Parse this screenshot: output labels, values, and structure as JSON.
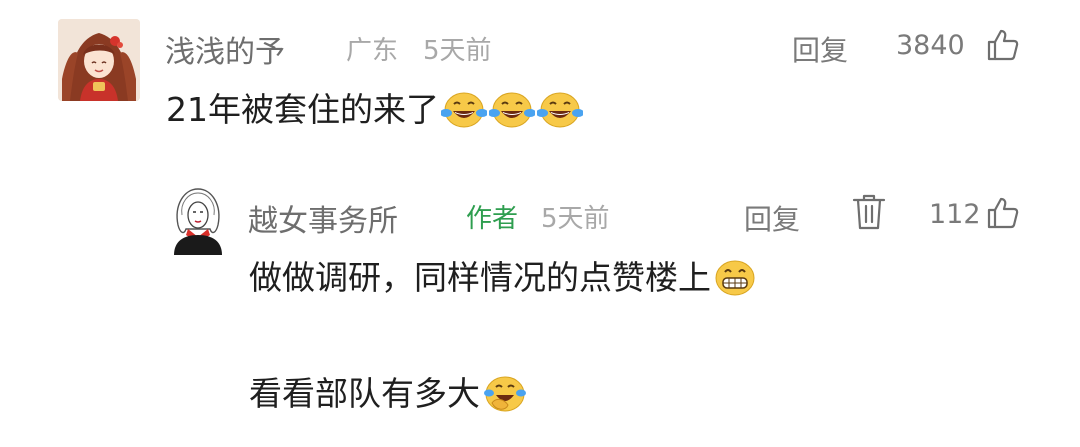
{
  "comment": {
    "username": "浅浅的予",
    "location": "广东",
    "time": "5天前",
    "reply_label": "回复",
    "like_count": "3840",
    "text": "21年被套住的来了",
    "emojis": [
      "laugh-cry-emoji",
      "laugh-cry-emoji",
      "laugh-cry-emoji"
    ]
  },
  "reply": {
    "username": "越女事务所",
    "author_tag": "作者",
    "time": "5天前",
    "reply_label": "回复",
    "like_count": "112",
    "line1": "做做调研，同样情况的点赞楼上",
    "line1_emoji": "grin-emoji",
    "line2": "看看部队有多大",
    "line2_emoji": "facepalm-laugh-emoji"
  },
  "colors": {
    "username": "#6e6e6e",
    "meta": "#a8a8a8",
    "author_tag": "#2e9e4f",
    "text": "#1f1f1f",
    "emoji_yellow": "#f7c948",
    "tear_blue": "#4aa3f0"
  }
}
